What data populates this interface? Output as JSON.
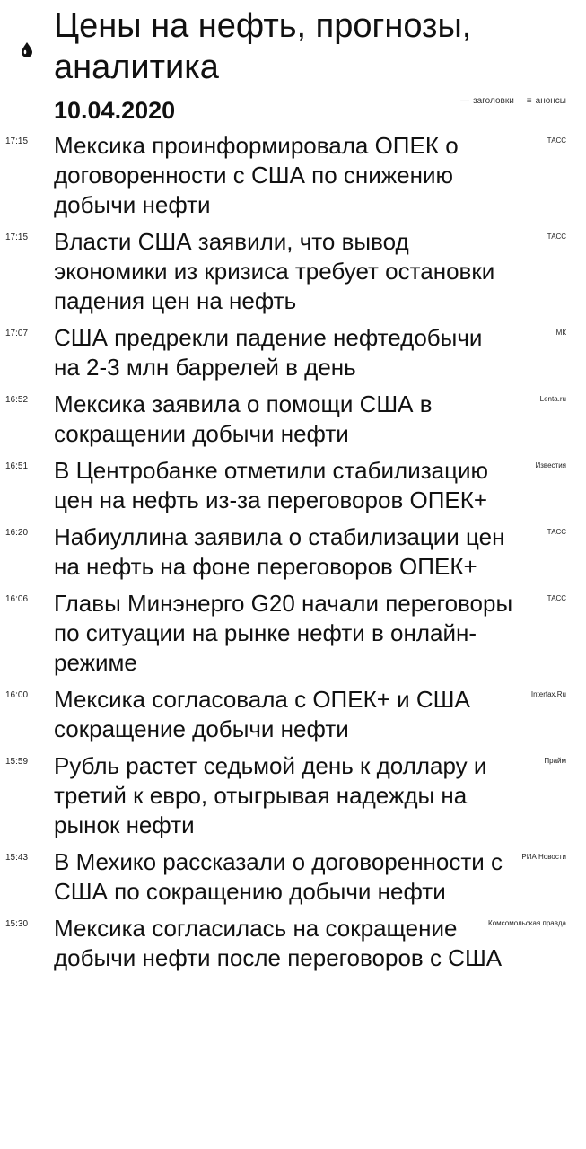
{
  "header": {
    "title": "Цены на нефть, прогнозы, аналитика",
    "date": "10.04.2020",
    "view_options": [
      {
        "label": "заголовки",
        "icon": "dash-icon"
      },
      {
        "label": "анонсы",
        "icon": "lines-icon"
      }
    ]
  },
  "news": [
    {
      "time": "17:15",
      "source": "ТАСС",
      "headline": "Мексика проинформировала ОПЕК о договоренности с США по снижению добычи нефти"
    },
    {
      "time": "17:15",
      "source": "ТАСС",
      "headline": "Власти США заявили, что вывод экономики из кризиса требует остановки падения цен на нефть"
    },
    {
      "time": "17:07",
      "source": "МК",
      "headline": "США предрекли падение нефтедобычи на 2-3 млн баррелей в день"
    },
    {
      "time": "16:52",
      "source": "Lenta.ru",
      "headline": "Мексика заявила о помощи США в сокращении добычи нефти"
    },
    {
      "time": "16:51",
      "source": "Известия",
      "headline": "В Центробанке отметили стабилизацию цен на нефть из-за переговоров ОПЕК+"
    },
    {
      "time": "16:20",
      "source": "ТАСС",
      "headline": "Набиуллина заявила о стабилизации цен на нефть на фоне переговоров ОПЕК+"
    },
    {
      "time": "16:06",
      "source": "ТАСС",
      "headline": "Главы Минэнерго G20 начали переговоры по ситуации на рынке нефти в онлайн-режиме"
    },
    {
      "time": "16:00",
      "source": "Interfax.Ru",
      "headline": "Мексика согласовала с ОПЕК+ и США сокращение добычи нефти"
    },
    {
      "time": "15:59",
      "source": "Прайм",
      "headline": "Рубль растет седьмой день к доллару и третий к евро, отыгрывая надежды на рынок нефти"
    },
    {
      "time": "15:43",
      "source": "РИА Новости",
      "headline": "В Мехико рассказали о договоренности с США по сокращению добычи нефти"
    },
    {
      "time": "15:30",
      "source": "Комсомольская правда",
      "headline": "Мексика согласилась на сокращение добычи нефти после переговоров с США"
    }
  ]
}
